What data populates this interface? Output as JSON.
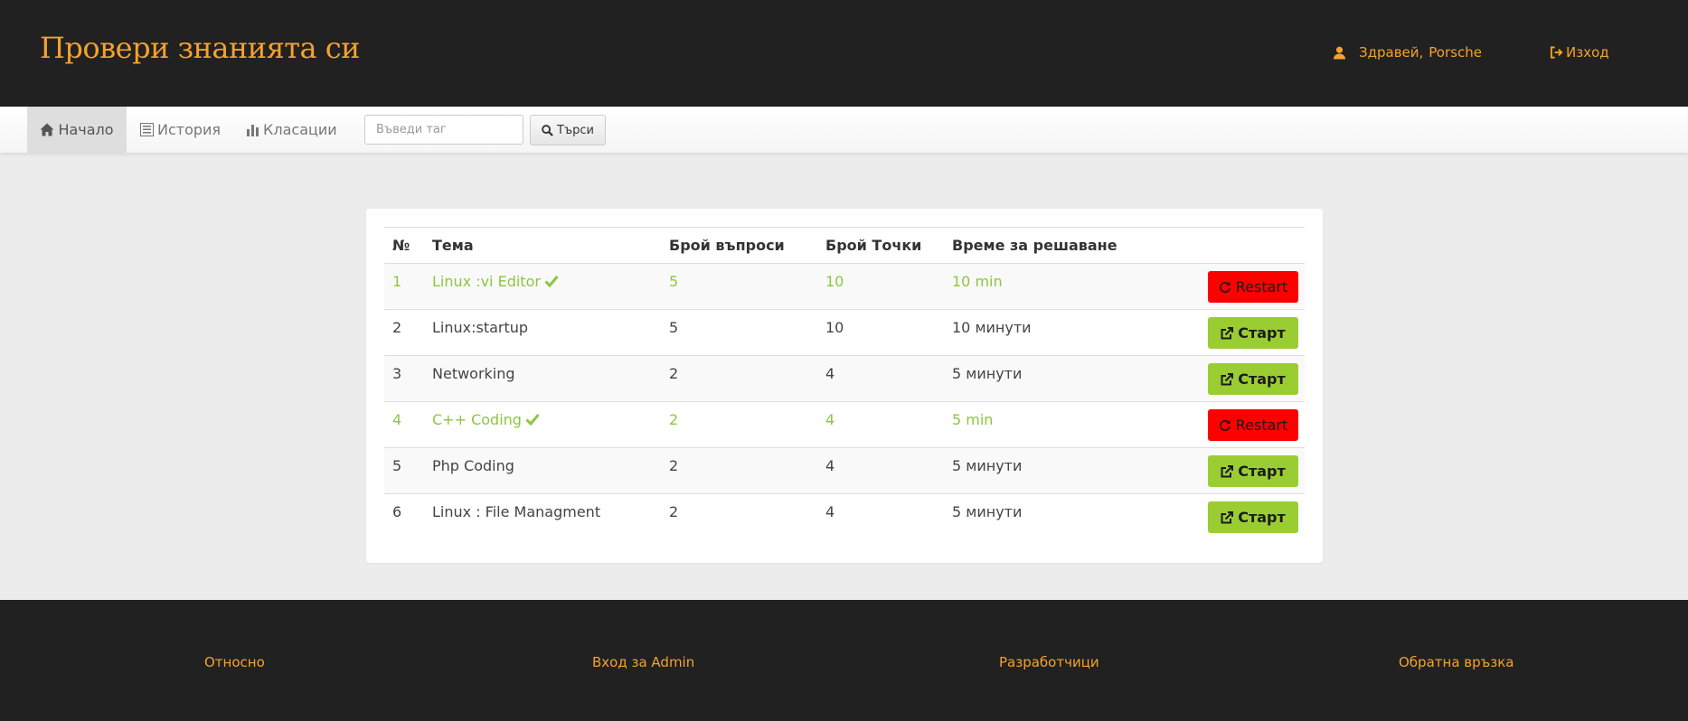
{
  "header": {
    "title": "Провери знанията си",
    "greeting_prefix": "Здравей,",
    "username": "Porsche",
    "logout_label": "Изход"
  },
  "nav": {
    "home": "Начало",
    "history": "История",
    "rankings": "Класации",
    "search_placeholder": "Въведи таг",
    "search_button": "Търси"
  },
  "table": {
    "headers": [
      "№",
      "Тема",
      "Брой въпроси",
      "Брой Точки",
      "Време за решаване"
    ],
    "rows": [
      {
        "num": "1",
        "topic": "Linux :vi Editor",
        "questions": "5",
        "points": "10",
        "time": "10 min",
        "completed": true,
        "action": "Restart"
      },
      {
        "num": "2",
        "topic": "Linux:startup",
        "questions": "5",
        "points": "10",
        "time": "10 минути",
        "completed": false,
        "action": "Старт"
      },
      {
        "num": "3",
        "topic": "Networking",
        "questions": "2",
        "points": "4",
        "time": "5 минути",
        "completed": false,
        "action": "Старт"
      },
      {
        "num": "4",
        "topic": "C++ Coding",
        "questions": "2",
        "points": "4",
        "time": "5 min",
        "completed": true,
        "action": "Restart"
      },
      {
        "num": "5",
        "topic": "Php Coding",
        "questions": "2",
        "points": "4",
        "time": "5 минути",
        "completed": false,
        "action": "Старт"
      },
      {
        "num": "6",
        "topic": "Linux : File Managment",
        "questions": "2",
        "points": "4",
        "time": "5 минути",
        "completed": false,
        "action": "Старт"
      }
    ]
  },
  "footer": {
    "about": "Относно",
    "admin_login": "Вход за Admin",
    "developers": "Разработчици",
    "feedback": "Обратна връзка"
  },
  "colors": {
    "accent": "#f4a22d",
    "completed": "#8dc63f",
    "start_button": "#9acd32",
    "restart_button": "#ff0000",
    "dark_bg": "#212121"
  }
}
